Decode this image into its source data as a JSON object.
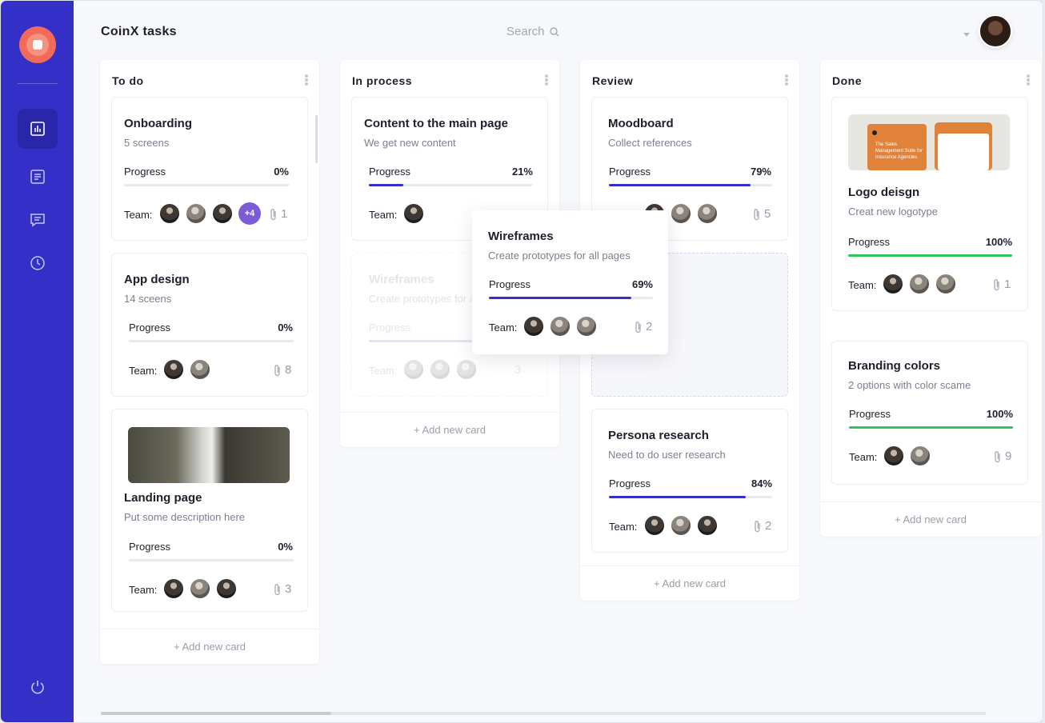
{
  "app": {
    "title": "CoinX tasks"
  },
  "search": {
    "placeholder": "Search"
  },
  "colors": {
    "accent": "#3430c7",
    "progress": "#3430c7",
    "done": "#2ec45b",
    "badge": "#7d5bd8"
  },
  "sidebar": {
    "items": [
      {
        "icon": "chart-icon",
        "active": true
      },
      {
        "icon": "document-icon",
        "active": false
      },
      {
        "icon": "chat-icon",
        "active": false
      },
      {
        "icon": "clock-icon",
        "active": false
      }
    ],
    "bottom_icon": "power-icon"
  },
  "labels": {
    "progress": "Progress",
    "team": "Team:",
    "add_card": "+ Add new card"
  },
  "columns": [
    {
      "title": "To do",
      "cards": [
        {
          "title": "Onboarding",
          "subtitle": "5 screens",
          "progress": "0%",
          "extra_members": "+4",
          "attachments": "1"
        },
        {
          "title": "App design",
          "subtitle": "14 sceens",
          "progress": "0%",
          "attachments": "8"
        },
        {
          "title": "Landing page",
          "subtitle": "Put some description here",
          "progress": "0%",
          "attachments": "3"
        }
      ]
    },
    {
      "title": "In process",
      "cards": [
        {
          "title": "Content to the main page",
          "subtitle": "We get new content",
          "progress": "21%"
        },
        {
          "title": "Wireframes",
          "subtitle": "Create prototypes for all pages",
          "progress": "69%",
          "attachments": "2",
          "ghost_attachments": "3"
        }
      ]
    },
    {
      "title": "Review",
      "cards": [
        {
          "title": "Moodboard",
          "subtitle": "Collect references",
          "progress": "79%",
          "attachments": "5"
        },
        {
          "title": "Persona research",
          "subtitle": "Need to do user research",
          "progress": "84%",
          "attachments": "2"
        }
      ]
    },
    {
      "title": "Done",
      "cards": [
        {
          "title": "Logo deisgn",
          "subtitle": "Creat new logotype",
          "progress": "100%",
          "attachments": "1",
          "image_text": "The Sales Management Suite for Insurance Agencies"
        },
        {
          "title": "Branding colors",
          "subtitle": "2 options with color scame",
          "progress": "100%",
          "attachments": "9"
        }
      ]
    }
  ]
}
